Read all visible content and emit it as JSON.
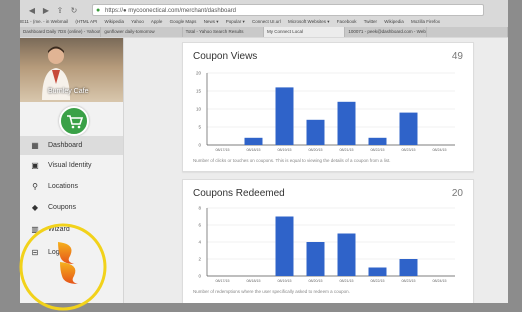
{
  "browser": {
    "url": "https://● mycoonectical.com/merchant/dashboard",
    "bookmarks": [
      "IE11 - (me. - in Webmail",
      "(HTML API",
      "Wikipedia",
      "Yahoo",
      "Apple",
      "Google Maps",
      "News ▾",
      "Popular ▾",
      "Connect UI.url",
      "Microsoft Websites ▾",
      "Facebook",
      "Twitter",
      "Wikipedia",
      "Mozilla Firefox"
    ],
    "tabs": [
      "Dashboard Daily 7DS (online) - Yahoo! Search 0",
      "gunflower daily-tomorrow",
      "Total - Yahoo Search Results",
      "My Connect Local",
      "100071 - peek@dashboard.com - Webmail",
      ""
    ]
  },
  "sidebar": {
    "profile_label": "Burnley Cafe",
    "items": [
      {
        "label": "Dashboard",
        "icon": "dashboard-icon",
        "glyph": "▦"
      },
      {
        "label": "Visual Identity",
        "icon": "image-icon",
        "glyph": "▣"
      },
      {
        "label": "Locations",
        "icon": "location-pin-icon",
        "glyph": "⚲"
      },
      {
        "label": "Coupons",
        "icon": "tag-icon",
        "glyph": "◆"
      },
      {
        "label": "Wizard",
        "icon": "wizard-icon",
        "glyph": "▥"
      },
      {
        "label": "Logout",
        "icon": "logout-icon",
        "glyph": "⊟"
      }
    ]
  },
  "colors": {
    "bar": "#2f63c9",
    "accent": "#3aa147",
    "highlight_ring": "#f2d21b"
  },
  "cards": [
    {
      "title": "Coupon Views",
      "count": "49",
      "note": "Number of clicks or touches on coupons. This is equal to viewing the details of a coupon from a list.",
      "chart_data": {
        "type": "bar",
        "categories": [
          "08/17/15",
          "08/18/15",
          "08/19/15",
          "08/20/15",
          "08/21/15",
          "08/22/15",
          "08/23/15",
          "08/24/15"
        ],
        "values": [
          0,
          2,
          16,
          7,
          12,
          2,
          9,
          0
        ],
        "yticks": [
          "0",
          "5",
          "10",
          "15",
          "20"
        ],
        "ylim": [
          0,
          20
        ]
      }
    },
    {
      "title": "Coupons Redeemed",
      "count": "20",
      "note": "Number of redemptions where the user specifically asked to redeem a coupon.",
      "chart_data": {
        "type": "bar",
        "categories": [
          "08/17/15",
          "08/18/15",
          "08/19/15",
          "08/20/15",
          "08/21/15",
          "08/22/15",
          "08/23/15",
          "08/24/15"
        ],
        "values": [
          0,
          0,
          7,
          4,
          5,
          1,
          2,
          0
        ],
        "yticks": [
          "0",
          "2",
          "4",
          "6",
          "8"
        ],
        "ylim": [
          0,
          8
        ]
      }
    }
  ]
}
